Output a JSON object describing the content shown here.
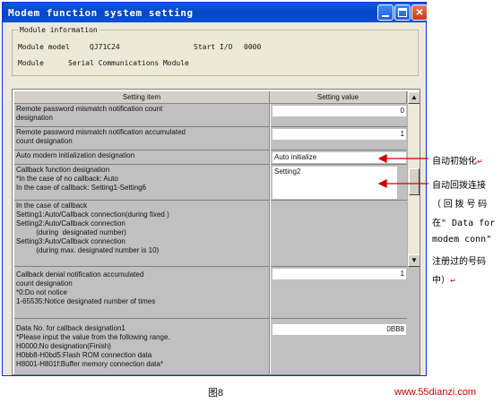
{
  "window": {
    "title": "Modem function system setting",
    "buttons": {
      "minimize": "minimize",
      "maximize": "maximize",
      "close": "×"
    }
  },
  "module_info": {
    "legend": "Module information",
    "model_label": "Module model",
    "model_value": "QJ71C24",
    "start_io_label": "Start I/O",
    "start_io_value": "0000",
    "module_label": "Module",
    "module_value": "Serial Communications Module"
  },
  "table": {
    "col_item": "Setting item",
    "col_value": "Setting value",
    "scroll_up": "▲",
    "scroll_down": "▼",
    "rows": [
      {
        "lines": [
          "Remote password mismatch notification count",
          "designation"
        ],
        "value": "0"
      },
      {
        "lines": [
          "Remote password mismatch notification accumulated",
          "count designation"
        ],
        "value": "1"
      },
      {
        "lines": [
          "Auto modem initialization designation"
        ],
        "value": "Auto initialize"
      },
      {
        "lines": [
          "Callback function designation",
          "*In the case of no callback: Auto",
          "In the case of callback: Setting1-Setting6"
        ],
        "value": "Setting2"
      },
      {
        "lines": [
          "In the case of callback",
          "Setting1:Auto/Callback connection(during fixed )",
          "Setting2:Auto/Callback connection",
          "          (during  designated number)",
          "Setting3:Auto/Callback connection",
          "          (during max. designated number is 10)"
        ],
        "value": ""
      },
      {
        "lines": [
          "Callback denial notification accumulated",
          "count designation",
          "*0:Do not notice",
          "1-65535:Notice designated number of times"
        ],
        "value": "1"
      },
      {
        "lines": [
          "Data No. for callback designation1",
          "*Please input the value from the following range.",
          "H0000:No designation(Finish)",
          "H0bb8-H0bd5:Flash ROM connection data",
          "H8001-H801f:Buffer memory connection data*"
        ],
        "value": "0BB8"
      }
    ]
  },
  "annotations": {
    "auto_init": "自动初始化",
    "callback_1": "自动回拨连接",
    "callback_2": "（ 回 拨 号 码",
    "callback_3": "在\" Data  for",
    "callback_4": "modem  conn\"",
    "callback_5": "注册过的号码",
    "callback_6": "中）",
    "return_mark": "↵",
    "arrow_color": "#cc0000"
  },
  "caption": "图8",
  "watermark": "www.55dianzi.com"
}
